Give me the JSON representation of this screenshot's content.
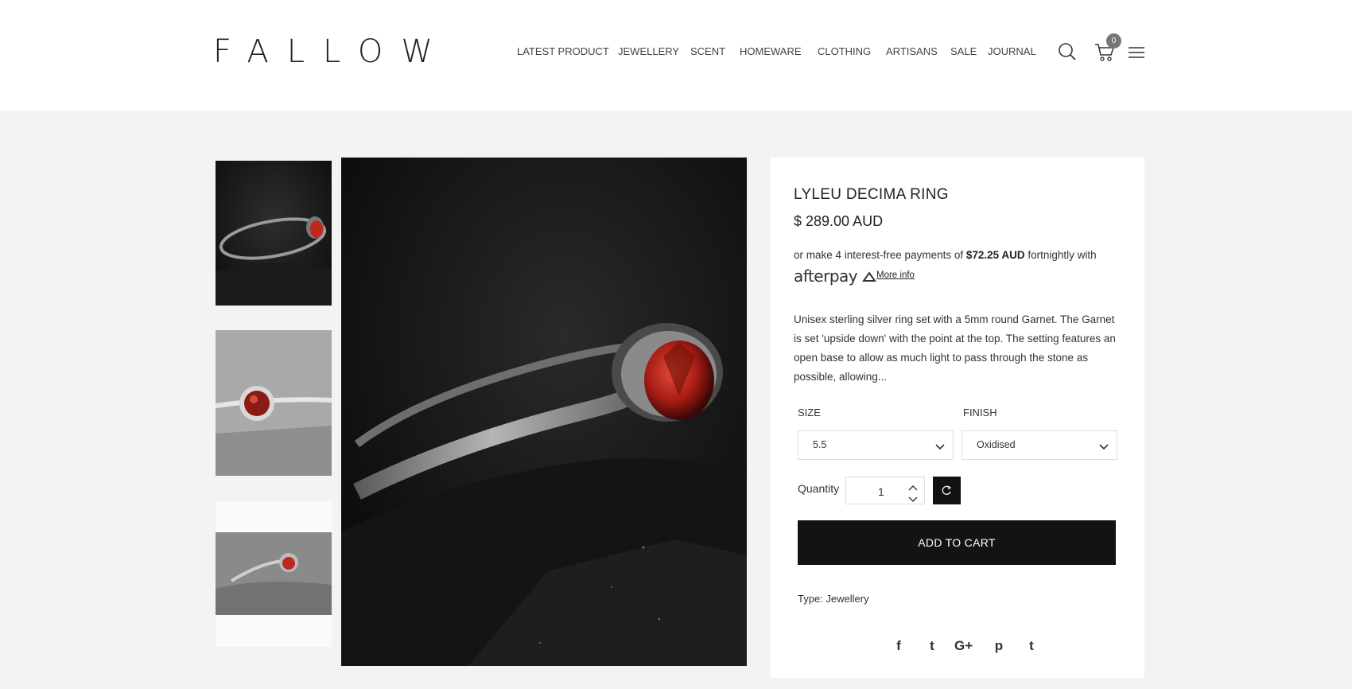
{
  "header": {
    "logo": "FALLOW",
    "nav": [
      "LATEST PRODUCT",
      "JEWELLERY",
      "SCENT",
      "HOMEWARE",
      "CLOTHING",
      "ARTISANS",
      "SALE",
      "JOURNAL"
    ],
    "cart_count": "0",
    "icons": [
      "search-icon",
      "cart-icon",
      "menu-icon"
    ]
  },
  "product": {
    "title": "LYLEU DECIMA RING",
    "price": "$ 289.00 AUD",
    "afterpay": {
      "prefix": "or make 4 interest-free payments of ",
      "amount": "$72.25 AUD",
      "suffix": " fortnightly with",
      "logo": "afterpay",
      "more_info": "More info"
    },
    "description": "Unisex sterling silver ring set with a 5mm round Garnet. The Garnet is set 'upside down' with the point at the top. The setting features an open base to allow as much light to pass through the stone as possible, allowing...",
    "size": {
      "label": "SIZE",
      "selected": "5.5"
    },
    "finish": {
      "label": "FINISH",
      "selected": "Oxidised"
    },
    "quantity": {
      "label": "Quantity",
      "value": "1"
    },
    "add_to_cart": "ADD TO CART",
    "type": "Type: Jewellery",
    "share": [
      "f",
      "t",
      "G+",
      "p",
      "t"
    ]
  },
  "colors": {
    "page_bg": "#f3f3f3",
    "button_bg": "#131313",
    "garnet": "#c0271f"
  }
}
